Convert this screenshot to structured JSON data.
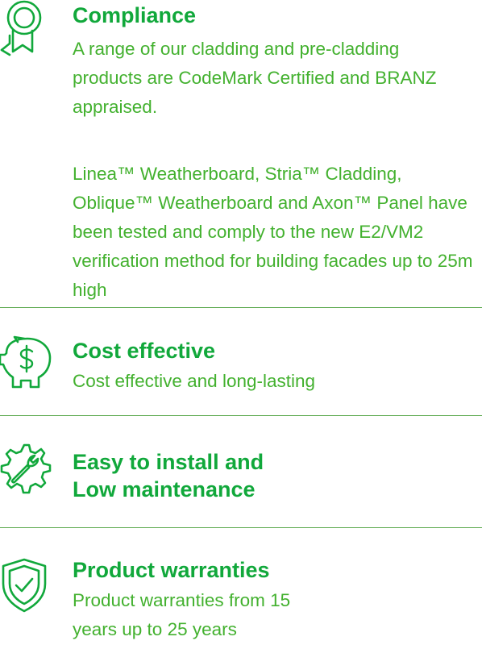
{
  "colors": {
    "heading": "#11a83b",
    "body": "#43b12f",
    "divider": "#5aa84c"
  },
  "features": [
    {
      "icon": "award-ribbon-icon",
      "title": "Compliance",
      "paragraphs": [
        "A range of our cladding and pre-cladding products are CodeMark Certified and BRANZ appraised.",
        "Linea™ Weatherboard, Stria™ Cladding, Oblique™ Weatherboard and Axon™ Panel have been tested and comply to the new E2/VM2 verification method for building facades up to 25m high"
      ]
    },
    {
      "icon": "piggy-bank-dollar-icon",
      "title": "Cost effective",
      "paragraphs": [
        "Cost effective and long-lasting"
      ]
    },
    {
      "icon": "wrench-gear-icon",
      "title_lines": [
        "Easy to install and",
        "Low maintenance"
      ]
    },
    {
      "icon": "shield-check-icon",
      "title": "Product warranties",
      "paragraphs": [
        "Product warranties from 15 years up to 25 years"
      ]
    }
  ]
}
